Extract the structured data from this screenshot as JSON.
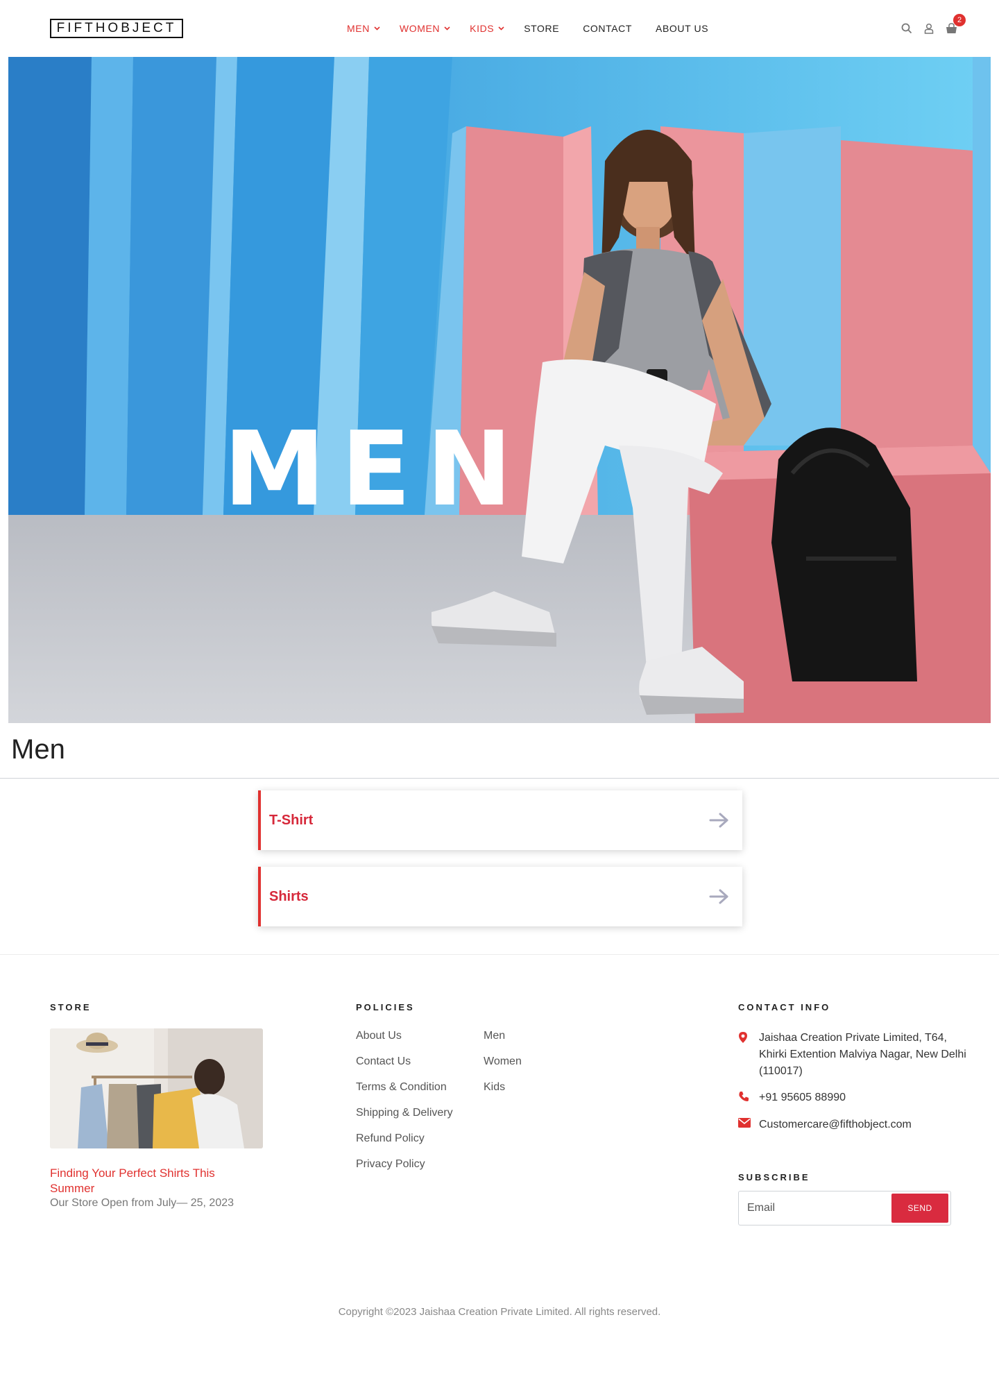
{
  "header": {
    "logo": "FIFTHOBJECT",
    "nav": [
      {
        "label": "MEN",
        "has_dropdown": true,
        "color": "#e0312f"
      },
      {
        "label": "WOMEN",
        "has_dropdown": true,
        "color": "#e0312f"
      },
      {
        "label": "KIDS",
        "has_dropdown": true,
        "color": "#e0312f"
      },
      {
        "label": "STORE",
        "has_dropdown": false
      },
      {
        "label": "CONTACT",
        "has_dropdown": false
      },
      {
        "label": "ABOUT US",
        "has_dropdown": false
      }
    ],
    "icons": [
      "search-icon",
      "user-icon",
      "cart-icon"
    ],
    "cart_count": "2"
  },
  "hero": {
    "title": "MEN"
  },
  "page": {
    "title": "Men"
  },
  "categories": [
    {
      "label": "T-Shirt"
    },
    {
      "label": "Shirts"
    }
  ],
  "footer": {
    "store": {
      "heading": "STORE",
      "post_title": "Finding Your Perfect Shirts This Summer",
      "post_subtitle": "Our Store Open from July— 25, 2023"
    },
    "policies": {
      "heading": "POLICIES",
      "col1": [
        "About Us",
        "Contact Us",
        "Terms & Condition",
        "Shipping & Delivery",
        "Refund Policy",
        "Privacy Policy"
      ],
      "col2": [
        "Men",
        "Women",
        "Kids"
      ]
    },
    "contact": {
      "heading": "CONTACT INFO",
      "address": "Jaishaa Creation Private Limited, T64, Khirki Extention Malviya Nagar, New Delhi (110017)",
      "phone": "+91 95605 88990",
      "email": "Customercare@fifthobject.com"
    },
    "subscribe": {
      "heading": "SUBSCRIBE",
      "placeholder": "Email",
      "button": "SEND"
    },
    "copyright": "Copyright ©2023 Jaishaa Creation Private Limited. All rights reserved."
  },
  "colors": {
    "accent": "#e0312f",
    "brand_red": "#d6283a",
    "hero_blue": "#3aa2e0",
    "hero_pink": "#e88a90"
  }
}
